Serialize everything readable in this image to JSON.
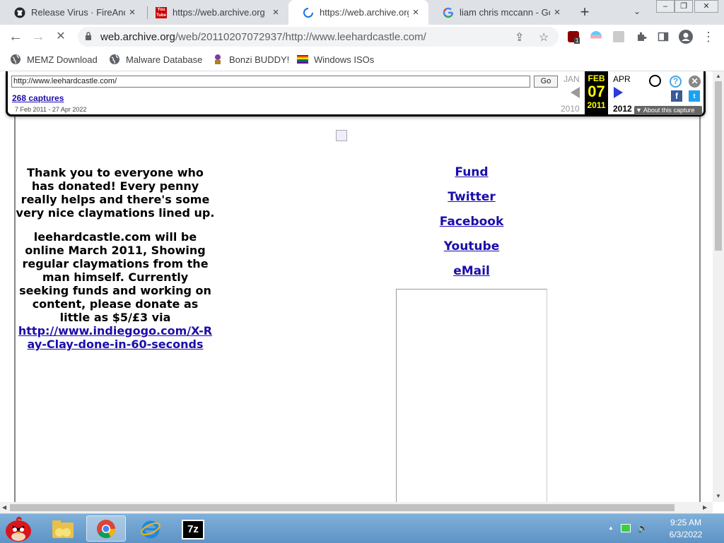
{
  "browser": {
    "tabs": [
      {
        "title": "Release Virus · FireAndr",
        "favicon": "github-icon",
        "active": false
      },
      {
        "title": "https://web.archive.org",
        "favicon": "youtube-icon",
        "favicon_text": "You Tube",
        "active": false
      },
      {
        "title": "https://web.archive.org",
        "favicon": "loading-spinner-icon",
        "active": true
      },
      {
        "title": "liam chris mccann - Go",
        "favicon": "google-icon",
        "active": false
      }
    ],
    "tab_close": "×",
    "new_tab": "+",
    "tab_search": "⌄",
    "window_buttons": {
      "minimize": "–",
      "restore": "❐",
      "close": "✕"
    },
    "toolbar": {
      "back": "←",
      "forward": "→",
      "stop": "✕",
      "url_host": "web.archive.org",
      "url_path": "/web/20110207072937/http://www.leehardcastle.com/",
      "share": "⇪",
      "star": "☆",
      "ext_badge": "1",
      "menu": "⋮"
    },
    "bookmarks": [
      {
        "label": "MEMZ Download",
        "icon": "globe-icon"
      },
      {
        "label": "Malware Database",
        "icon": "globe-icon"
      },
      {
        "label": "Bonzi BUDDY!",
        "icon": "bonzi-icon"
      },
      {
        "label": "Windows ISOs",
        "icon": "rainbow-flag-icon"
      }
    ]
  },
  "wayback": {
    "url_input": "http://www.leehardcastle.com/",
    "go_label": "Go",
    "captures_link": "268 captures",
    "date_range": "7 Feb 2011 - 27 Apr 2022",
    "prev_month": "JAN",
    "prev_year": "2010",
    "current_month": "FEB",
    "current_day": "07",
    "current_year": "2011",
    "next_month": "APR",
    "next_year": "2012",
    "about_label": "▼ About this capture",
    "help_icon_text": "?",
    "close_icon_text": "✕",
    "facebook_icon_text": "f",
    "twitter_icon_text": "t"
  },
  "page": {
    "paragraph1": "Thank you to everyone who has donated! Every penny really helps and there's some very nice claymations lined up.",
    "paragraph2": "leehardcastle.com will be online March 2011, Showing regular claymations from the man himself. Currently seeking funds and working on content, please donate as little as $5/£3 via",
    "donate_link": "http://www.indiegogo.com/X-Ray-Clay-done-in-60-seconds",
    "nav_links": [
      "Fund",
      "Twitter",
      "Facebook",
      "Youtube",
      "eMail"
    ]
  },
  "taskbar": {
    "apps": [
      {
        "name": "angry-birds-start-icon"
      },
      {
        "name": "folder-icon"
      },
      {
        "name": "chrome-icon",
        "active": true
      },
      {
        "name": "internet-explorer-icon"
      },
      {
        "name": "7zip-icon",
        "text": "7z"
      }
    ],
    "tray_chevron": "▲",
    "volume": "🔈",
    "time": "9:25 AM",
    "date": "6/3/2022"
  }
}
